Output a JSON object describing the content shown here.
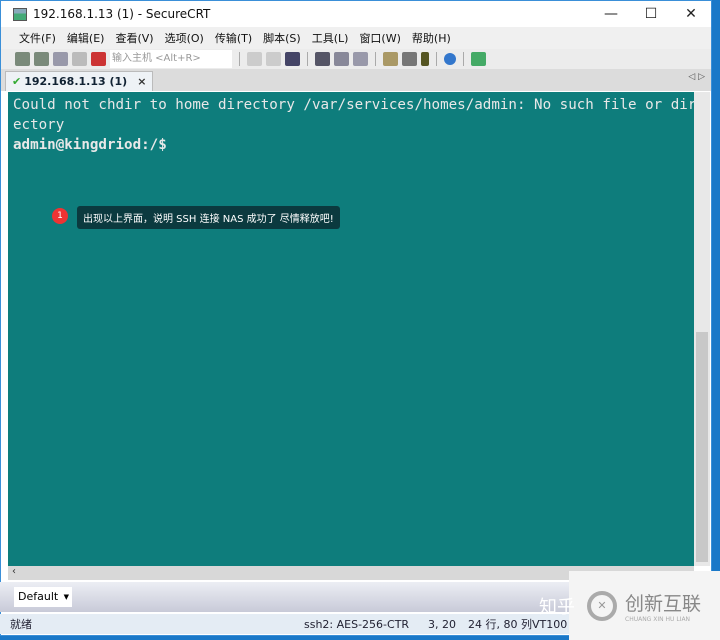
{
  "window": {
    "title": "192.168.1.13 (1) - SecureCRT",
    "minimize": "—",
    "maximize": "☐",
    "close": "✕"
  },
  "menu": [
    "文件(F)",
    "编辑(E)",
    "查看(V)",
    "选项(O)",
    "传输(T)",
    "脚本(S)",
    "工具(L)",
    "窗口(W)",
    "帮助(H)"
  ],
  "toolbar": {
    "host_placeholder": "输入主机 <Alt+R>"
  },
  "tab": {
    "label": "192.168.1.13 (1)",
    "close": "×",
    "check": "✔"
  },
  "tabnav": "◁ ▷",
  "terminal": {
    "lines": [
      "Could not chdir to home directory /var/services/homes/admin: No such file or dir",
      "ectory",
      "admin@kingdriod:/$"
    ]
  },
  "annotation": {
    "number": "1",
    "text": "出现以上界面，说明 SSH 连接 NAS 成功了 尽情释放吧!"
  },
  "session_select": {
    "value": "Default"
  },
  "status": {
    "ready": "就绪",
    "cipher": "ssh2: AES-256-CTR",
    "cursor": "3, 20",
    "size": "24 行, 80 列",
    "term": "VT100"
  },
  "watermark": {
    "zhihu": "知乎",
    "brand": "创新互联",
    "brand_sub": "CHUANG XIN HU LIAN"
  }
}
